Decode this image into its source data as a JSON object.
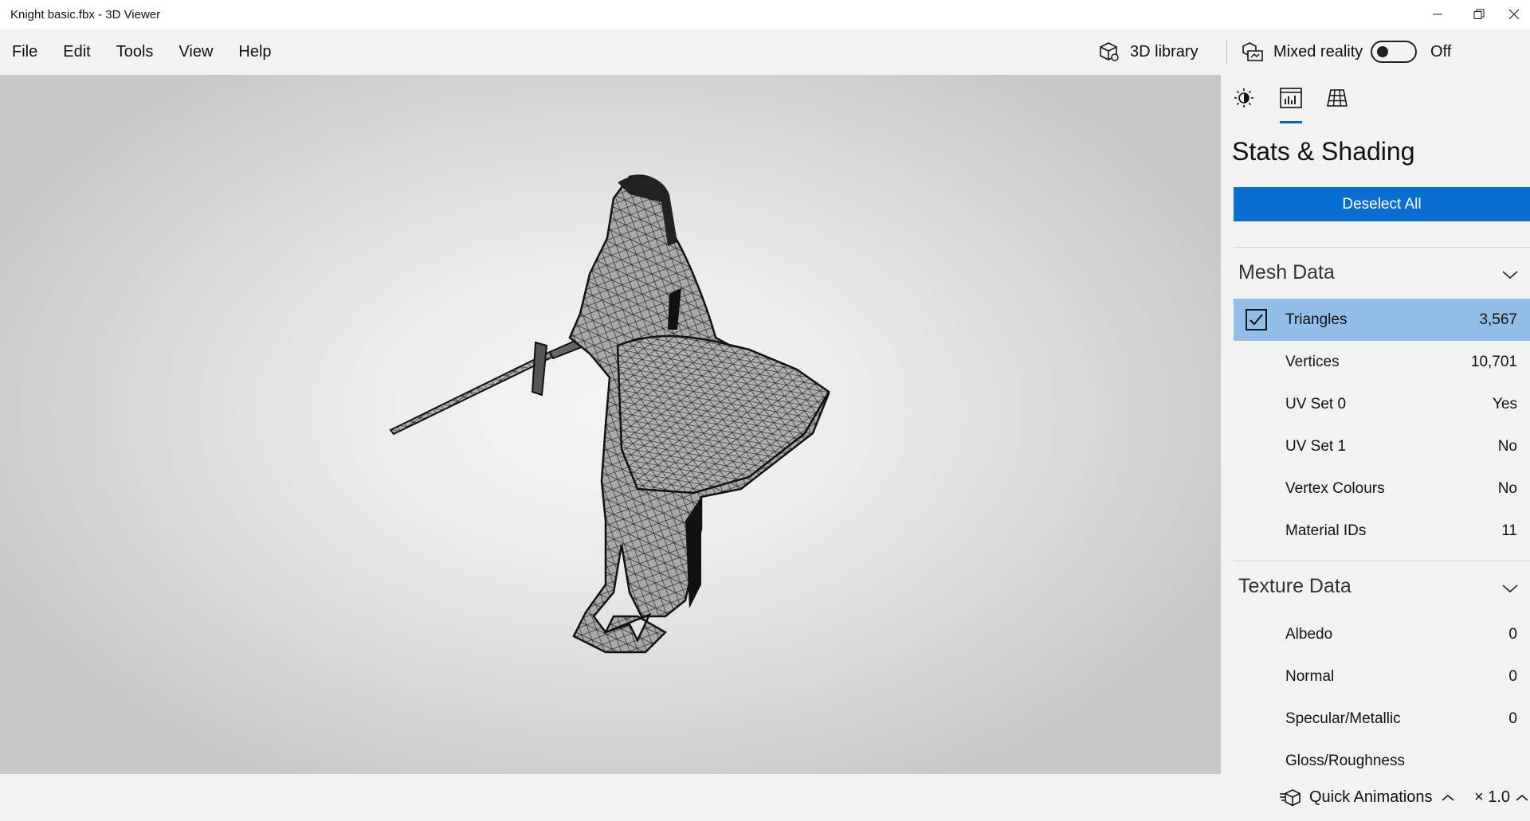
{
  "window": {
    "title": "Knight basic.fbx - 3D Viewer"
  },
  "menu": {
    "items": [
      "File",
      "Edit",
      "Tools",
      "View",
      "Help"
    ]
  },
  "toolbar": {
    "library_label": "3D library",
    "mixed_reality_label": "Mixed reality",
    "mixed_reality_state": "Off",
    "mixed_reality_on": false
  },
  "panel": {
    "title": "Stats & Shading",
    "deselect_label": "Deselect All",
    "mesh": {
      "heading": "Mesh Data",
      "rows": [
        {
          "label": "Triangles",
          "value": "3,567"
        },
        {
          "label": "Vertices",
          "value": "10,701"
        },
        {
          "label": "UV Set 0",
          "value": "Yes"
        },
        {
          "label": "UV Set 1",
          "value": "No"
        },
        {
          "label": "Vertex Colours",
          "value": "No"
        },
        {
          "label": "Material IDs",
          "value": "11"
        }
      ]
    },
    "texture": {
      "heading": "Texture Data",
      "rows": [
        {
          "label": "Albedo",
          "value": "0"
        },
        {
          "label": "Normal",
          "value": "0"
        },
        {
          "label": "Specular/Metallic",
          "value": "0"
        },
        {
          "label": "Gloss/Roughness",
          "value": ""
        }
      ]
    }
  },
  "status": {
    "animations_label": "Quick Animations",
    "speed_label": "× 1.0"
  },
  "colors": {
    "accent": "#0a6ed1",
    "selected_row": "#92bde6"
  }
}
